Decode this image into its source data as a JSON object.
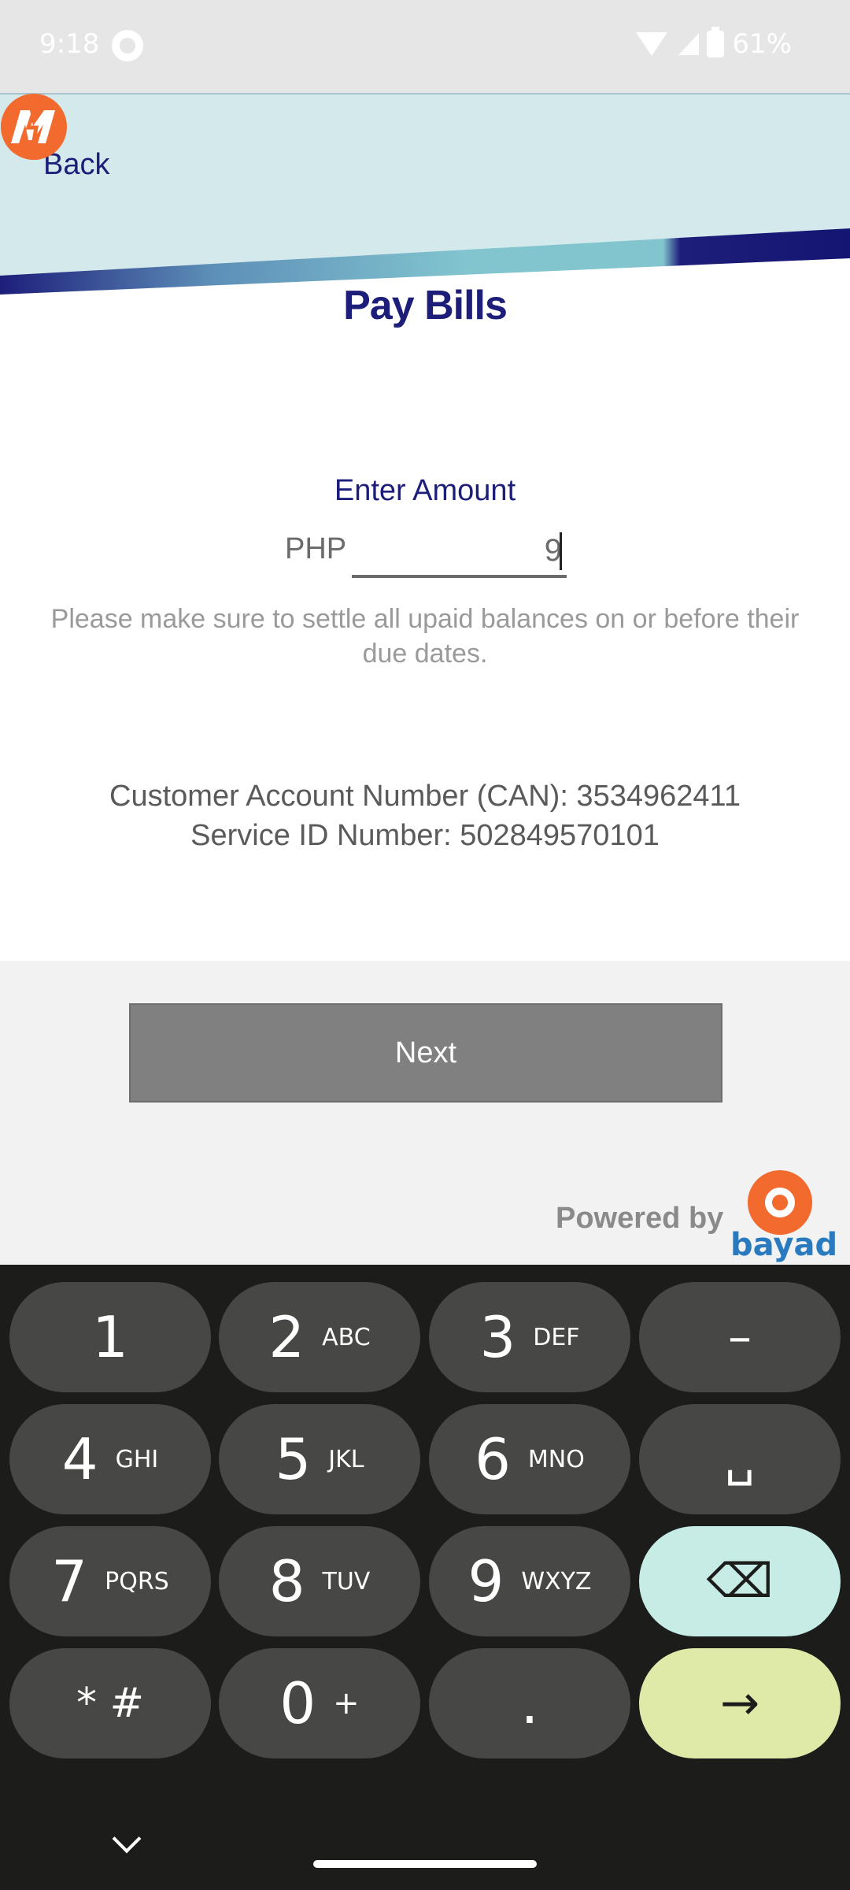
{
  "status": {
    "time": "9:18",
    "battery": "61%"
  },
  "header": {
    "back_label": "Back",
    "title": "Pay Bills"
  },
  "amount": {
    "label": "Enter Amount",
    "currency": "PHP",
    "value": "9"
  },
  "hint": "Please make sure to settle all upaid balances on or before their due dates.",
  "account": {
    "can_line": "Customer Account Number (CAN): 3534962411",
    "service_line": "Service ID Number: 502849570101"
  },
  "footer": {
    "next_label": "Next",
    "powered_by": "Powered by",
    "bayad_text": "bayad"
  },
  "keyboard": {
    "keys": [
      {
        "main": "1",
        "sub": ""
      },
      {
        "main": "2",
        "sub": "ABC"
      },
      {
        "main": "3",
        "sub": "DEF"
      },
      {
        "main": "–",
        "sub": ""
      },
      {
        "main": "4",
        "sub": "GHI"
      },
      {
        "main": "5",
        "sub": "JKL"
      },
      {
        "main": "6",
        "sub": "MNO"
      },
      {
        "main": "␣",
        "sub": ""
      },
      {
        "main": "7",
        "sub": "PQRS"
      },
      {
        "main": "8",
        "sub": "TUV"
      },
      {
        "main": "9",
        "sub": "WXYZ"
      },
      {
        "main": "⌫",
        "sub": ""
      },
      {
        "main": "* #",
        "sub": ""
      },
      {
        "main": "0",
        "sub": "+"
      },
      {
        "main": ".",
        "sub": ""
      },
      {
        "main": "→",
        "sub": ""
      }
    ]
  },
  "colors": {
    "brand_navy": "#1d1e7a",
    "logo_orange": "#f26a2e",
    "banner_light": "#d4e9ec",
    "banner_teal": "#82c5cf"
  }
}
